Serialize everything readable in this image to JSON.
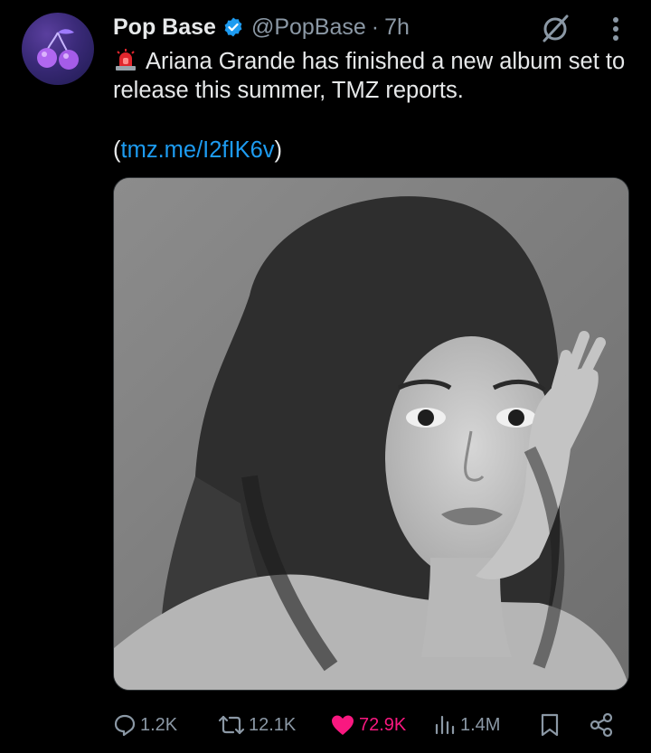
{
  "tweet": {
    "display_name": "Pop Base",
    "handle": "@PopBase",
    "separator": "·",
    "time": "7h",
    "text": "Ariana Grande has finished a new album set to release this summer, TMZ reports.",
    "link_open": "(",
    "link_text": "tmz.me/I2fIK6v",
    "link_close": ")",
    "media_alt": "Black-and-white portrait photo",
    "verified": true
  },
  "icons": {
    "avatar": "cherries-avatar",
    "verified": "verified-badge-icon",
    "grok": "grok-icon",
    "more": "more-vertical-icon",
    "siren": "police-siren-emoji",
    "reply": "reply-icon",
    "retweet": "retweet-icon",
    "like": "heart-filled-icon",
    "views": "views-icon",
    "bookmark": "bookmark-icon",
    "share": "share-icon"
  },
  "actions": {
    "reply_count": "1.2K",
    "retweet_count": "12.1K",
    "like_count": "72.9K",
    "views_count": "1.4M"
  },
  "colors": {
    "background": "#000000",
    "text_primary": "#e7e9ea",
    "text_secondary": "#8b98a5",
    "link": "#1d9bf0",
    "like": "#f91880",
    "verified": "#1d9bf0"
  }
}
